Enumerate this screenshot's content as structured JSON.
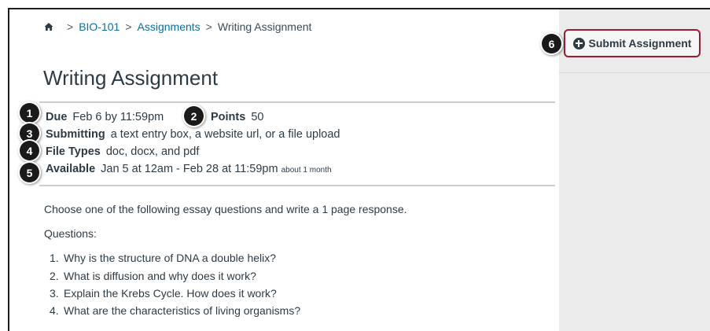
{
  "breadcrumb": {
    "home_icon": "home-icon",
    "course": "BIO-101",
    "section": "Assignments",
    "current": "Writing Assignment",
    "separator": ">"
  },
  "page_title": "Writing Assignment",
  "details": {
    "due_label": "Due",
    "due_value": "Feb 6 by 11:59pm",
    "points_label": "Points",
    "points_value": "50",
    "submitting_label": "Submitting",
    "submitting_value": "a text entry box, a website url, or a file upload",
    "file_types_label": "File Types",
    "file_types_value": "doc, docx, and pdf",
    "available_label": "Available",
    "available_value": "Jan 5 at 12am - Feb 28 at 11:59pm",
    "available_note": "about 1 month"
  },
  "description": {
    "intro": "Choose one of the following essay questions and write a 1 page response.",
    "questions_label": "Questions:",
    "questions": [
      {
        "num": "1.",
        "text": "Why is the structure of DNA a double helix?"
      },
      {
        "num": "2.",
        "text": "What is diffusion and why does it work?"
      },
      {
        "num": "3.",
        "text": "Explain the Krebs Cycle. How does it work?"
      },
      {
        "num": "4.",
        "text": "What are the characteristics of living organisms?"
      }
    ]
  },
  "sidebar": {
    "submit_label": "Submit Assignment",
    "submit_icon": "plus-circle-icon",
    "accent_color": "#9b1b30"
  },
  "callouts": [
    "1",
    "2",
    "3",
    "4",
    "5",
    "6"
  ]
}
